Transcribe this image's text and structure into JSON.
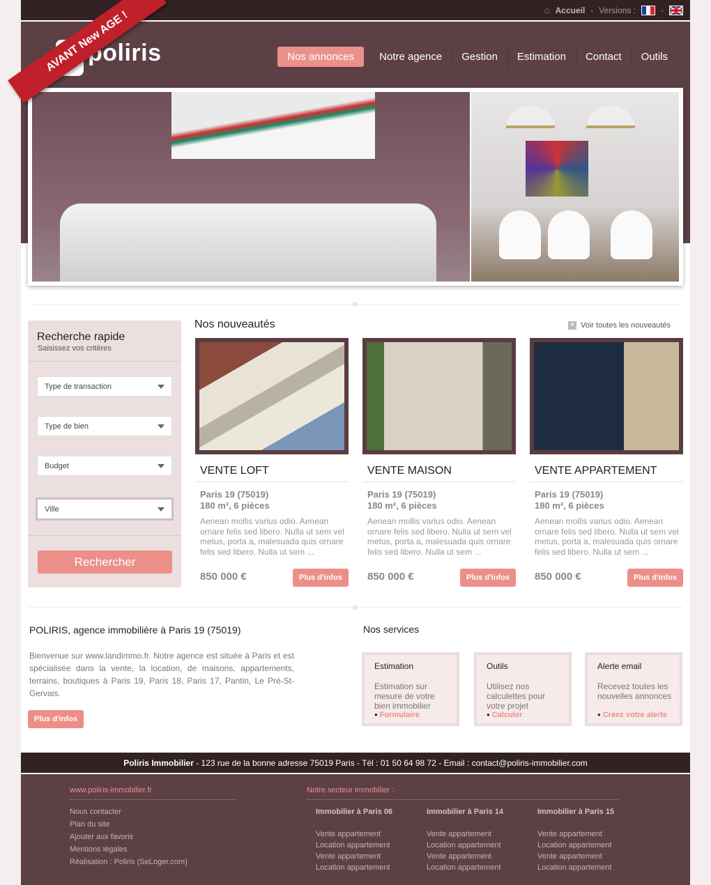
{
  "topbar": {
    "home": "Accueil",
    "sep1": "-",
    "versions": "Versions :",
    "sep2": "-"
  },
  "brand": {
    "logo_text": "poliris",
    "logo_glyph": "ô"
  },
  "nav": [
    "Nos annonces",
    "Notre agence",
    "Gestion",
    "Estimation",
    "Contact",
    "Outils"
  ],
  "banner": {
    "ribbon": "AVANT New AGE !"
  },
  "search": {
    "title": "Recherche rapide",
    "subtitle": "Saisissez vos critères",
    "fields": [
      "Type de transaction",
      "Type de bien",
      "Budget",
      "Ville"
    ],
    "button": "Rechercher"
  },
  "news": {
    "title": "Nos nouveautés",
    "see_all": "Voir toutes les nouveautés",
    "items": [
      {
        "type": "VENTE LOFT",
        "location": "Paris 19 (75019)",
        "size": "180 m², 6 pièces",
        "desc": "Aenean mollis varius odio. Aenean ornare felis sed libero. Nulla ut sem vel metus, porta a, malesuada quis ornare felis sed libero. Nulla ut sem  ...",
        "price": "850 000 €",
        "button": "Plus d'infos"
      },
      {
        "type": "VENTE MAISON",
        "location": "Paris 19 (75019)",
        "size": "180 m², 6 pièces",
        "desc": "Aenean mollis varius odio. Aenean ornare felis sed libero. Nulla ut sem vel metus, porta a, malesuada quis ornare felis sed libero. Nulla ut sem  ...",
        "price": "850 000 €",
        "button": "Plus d'infos"
      },
      {
        "type": "VENTE APPARTEMENT",
        "location": "Paris 19 (75019)",
        "size": "180 m², 6 pièces",
        "desc": "Aenean mollis varius odio. Aenean ornare felis sed libero. Nulla ut sem vel metus, porta a, malesuada quis ornare felis sed libero. Nulla ut sem  ...",
        "price": "850 000 €",
        "button": "Plus d'infos"
      }
    ]
  },
  "about": {
    "title": "POLIRIS, agence immobilière à Paris 19 (75019)",
    "text": "Bienvenue sur www.landimmo.fr. Notre agence est située à Paris et est spécialisée dans la vente, la location, de maisons, appartements, terrains, boutiques à Paris 19, Paris 18, Paris 17, Pantin, Le Pré-St-Gervais.",
    "button": "Plus d'infos"
  },
  "services": {
    "title": "Nos services",
    "items": [
      {
        "title": "Estimation",
        "desc": "Estimation sur mesure de votre bien immobilier",
        "link": "Formulaire"
      },
      {
        "title": "Outils",
        "desc": "Utilisez nos calculettes pour votre projet",
        "link": "Calculer"
      },
      {
        "title": "Alerte email",
        "desc": "Recevez toutes les nouvelles annonces",
        "link": "Créez votre alerte"
      }
    ]
  },
  "address": {
    "name": "Poliris Immobilier",
    "text": " - 123 rue de la bonne adresse 75019 Paris - Tél : 01 50 64 98 72 - Email : contact@poliris-immobilier.com"
  },
  "footer": {
    "site": "www.poliris-immobilier.fr",
    "links": [
      "Nous contacter",
      "Plan du site",
      "Ajouter aux favoris",
      "Mentions légales",
      "Réalisation : Poliris (SeLoger.com)"
    ],
    "sector_title": "Notre secteur immobilier :",
    "columns": [
      {
        "title": "Immobilier à Paris 06",
        "links": [
          "Vente appartement",
          "Location appartement",
          "Vente appartement",
          "Location appartement"
        ]
      },
      {
        "title": "Immobilier à Paris 14",
        "links": [
          "Vente appartement",
          "Location appartement",
          "Vente appartement",
          "Location appartement"
        ]
      },
      {
        "title": "Immobilier à Paris 15",
        "links": [
          "Vente appartement",
          "Location appartement",
          "Vente appartement",
          "Location appartement"
        ]
      }
    ]
  },
  "colors": {
    "accent": "#eb8f88",
    "brand": "#5d4046",
    "dark": "#322224"
  }
}
